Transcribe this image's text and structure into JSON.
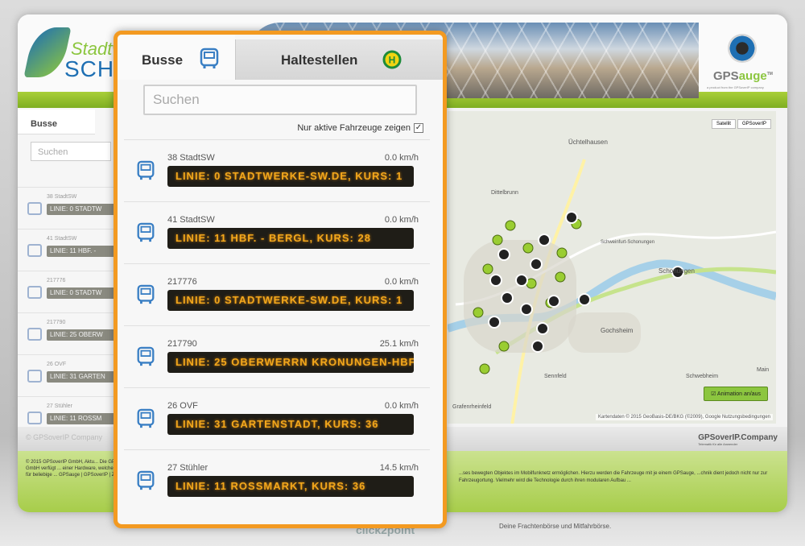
{
  "background_page": {
    "logo": {
      "line1": "Stadtw",
      "line2": "SCHW",
      "line3": "Zu"
    },
    "gps_logo": {
      "name_prefix": "GPS",
      "name_suffix": "auge",
      "trademark": "TM",
      "tagline": "a product from the GPSoverIP company"
    },
    "left_panel": {
      "tab_label": "Busse",
      "search_placeholder": "Suchen",
      "rows": [
        {
          "vehicle": "38 StadtSW",
          "line": "LINIE: 0 STADTW"
        },
        {
          "vehicle": "41 StadtSW",
          "line": "LINIE: 11 HBF. -"
        },
        {
          "vehicle": "217776",
          "line": "LINIE: 0 STADTW"
        },
        {
          "vehicle": "217790",
          "line": "LINIE: 25 OBERW"
        },
        {
          "vehicle": "26 OVF",
          "line": "LINIE: 31 GARTEN"
        },
        {
          "vehicle": "27 Stühler",
          "line": "LINIE: 11 ROSSM"
        }
      ]
    },
    "map": {
      "buttons": [
        "Satellit",
        "GPSoverIP"
      ],
      "places": [
        "Üchtelhausen",
        "Dittelbrunn",
        "Schonungen",
        "Gochsheim",
        "Schwebheim",
        "Sennfeld",
        "Schweinfurt-Schonungen",
        "Grafenrheinfeld",
        "Main"
      ],
      "animation_label": "Animation an/aus",
      "attribution": "Kartendaten © 2015 GeoBasis-DE/BKG (©2009), Google   Nutzungsbedingungen"
    },
    "footer": {
      "copyright_left": "© GPSoverIP Company",
      "gps_brand": "GPSoverIP.Company",
      "gps_tagline": "Telematik für alle Anwender",
      "left_text": "© 2015 GPSoverIP GmbH, Aktu... Die GPSoverIP GmbH verfügt ... einer Hardware, welche die G... Kurs für beliebige ... GPSauge | GPSoverIP | Zur Fre...",
      "right_text": "...ses bewegten Objektes im Mobilfunknetz ermöglichen. Hierzu werden die Fahrzeuge mit je einem GPSauge, ...chnik dient jedoch nicht nur zur Fahrzeugortung. Vielmehr wird die Technologie durch ihren modularen Aufbau ...",
      "below_logo": "click2point",
      "below_text": "Deine Frachtenbörse und Mitfahrbörse."
    }
  },
  "widget": {
    "tabs": [
      {
        "label": "Busse",
        "icon": "bus-icon",
        "active": true
      },
      {
        "label": "Haltestellen",
        "icon": "bus-stop-icon",
        "icon_text": "H",
        "active": false
      }
    ],
    "search": {
      "placeholder": "Suchen",
      "value": ""
    },
    "active_only": {
      "label": "Nur aktive Fahrzeuge zeigen",
      "checked": true
    },
    "vehicles": [
      {
        "id": "38 StadtSW",
        "speed": "0.0 km/h",
        "line": "LINIE: 0 STADTWERKE-SW.DE, KURS: 1"
      },
      {
        "id": "41 StadtSW",
        "speed": "0.0 km/h",
        "line": "LINIE: 11 HBF. - BERGL, KURS: 28"
      },
      {
        "id": "217776",
        "speed": "0.0 km/h",
        "line": "LINIE: 0 STADTWERKE-SW.DE, KURS: 1"
      },
      {
        "id": "217790",
        "speed": "25.1 km/h",
        "line": "LINIE: 25 OBERWERRN KRONUNGEN-HBF"
      },
      {
        "id": "26 OVF",
        "speed": "0.0 km/h",
        "line": "LINIE: 31 GARTENSTADT, KURS: 36"
      },
      {
        "id": "27 Stühler",
        "speed": "14.5 km/h",
        "line": "LINIE: 11 ROSSMARKT, KURS: 36"
      }
    ]
  },
  "colors": {
    "accent": "#f39a21",
    "led_text": "#f2a71c",
    "led_bg": "#1f1d17",
    "bus_icon": "#3a7fc4",
    "green": "#8cc63f"
  }
}
